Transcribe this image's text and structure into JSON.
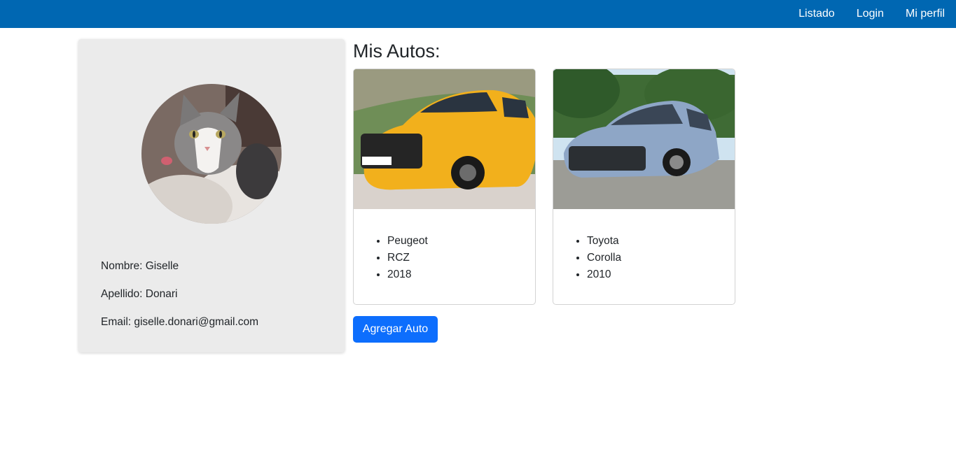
{
  "nav": {
    "links": [
      "Listado",
      "Login",
      "Mi perfil"
    ]
  },
  "profile": {
    "name": "Nombre: Giselle",
    "lastname": "Apellido: Donari",
    "email": "Email: giselle.donari@gmail.com"
  },
  "main": {
    "title": "Mis Autos:",
    "cars": [
      {
        "brand": "Peugeot",
        "model": "RCZ",
        "year": "2018",
        "color": "#f2b01c"
      },
      {
        "brand": "Toyota",
        "model": "Corolla",
        "year": "2010",
        "color": "#8ea6c6"
      }
    ],
    "add_button": "Agregar Auto"
  },
  "colors": {
    "navbar": "#0067b2",
    "button": "#0d6efd",
    "profile_bg": "#ebebeb"
  }
}
